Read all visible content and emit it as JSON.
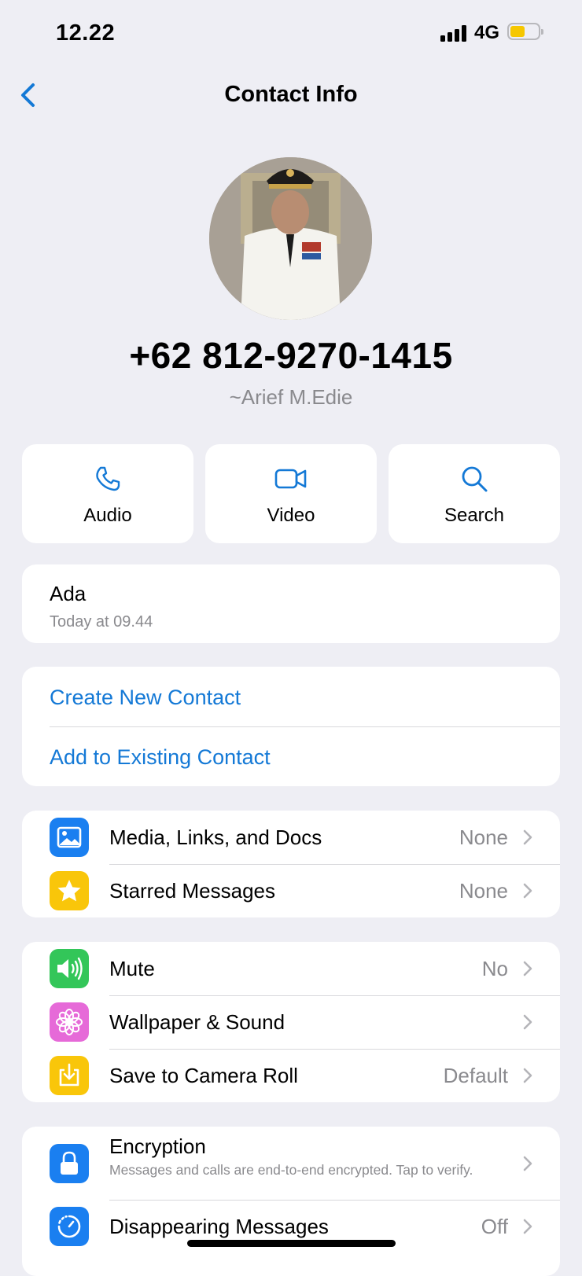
{
  "status_bar": {
    "time": "12.22",
    "network": "4G"
  },
  "nav": {
    "title": "Contact Info"
  },
  "profile": {
    "phone": "+62 812-9270-1415",
    "name": "~Arief M.Edie"
  },
  "actions": [
    {
      "label": "Audio",
      "icon": "phone-icon"
    },
    {
      "label": "Video",
      "icon": "video-icon"
    },
    {
      "label": "Search",
      "icon": "search-icon"
    }
  ],
  "status": {
    "text": "Ada",
    "time": "Today at 09.44"
  },
  "contact_links": {
    "create": "Create New Contact",
    "add_existing": "Add to Existing Contact"
  },
  "media_group": [
    {
      "label": "Media, Links, and Docs",
      "value": "None",
      "icon": "photo-icon",
      "color": "#1a7ff0"
    },
    {
      "label": "Starred Messages",
      "value": "None",
      "icon": "star-icon",
      "color": "#f9c60a"
    }
  ],
  "settings_group": [
    {
      "label": "Mute",
      "value": "No",
      "icon": "speaker-icon",
      "color": "#33c659"
    },
    {
      "label": "Wallpaper & Sound",
      "value": "",
      "icon": "flower-icon",
      "color": "#e66ad8"
    },
    {
      "label": "Save to Camera Roll",
      "value": "Default",
      "icon": "download-icon",
      "color": "#f9c60a"
    }
  ],
  "security_group": {
    "encryption": {
      "label": "Encryption",
      "desc": "Messages and calls are end-to-end encrypted. Tap to verify.",
      "icon": "lock-icon",
      "color": "#1a7ff0"
    },
    "disappearing": {
      "label": "Disappearing Messages",
      "value": "Off",
      "icon": "timer-icon",
      "color": "#1a7ff0"
    }
  },
  "colors": {
    "accent": "#1479d6",
    "background": "#eeeef4"
  }
}
